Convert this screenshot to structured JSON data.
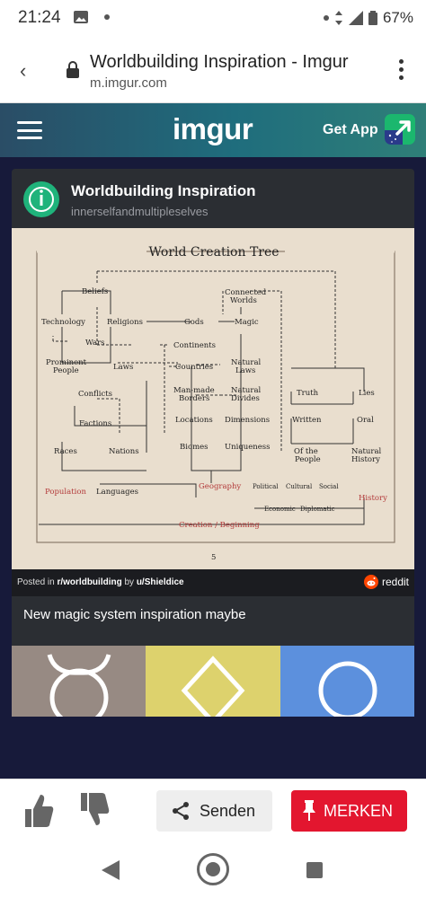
{
  "status_bar": {
    "time": "21:24",
    "battery": "67%"
  },
  "browser": {
    "title": "Worldbuilding Inspiration - Imgur",
    "url": "m.imgur.com"
  },
  "imgur_header": {
    "logo": "imgur",
    "get_app": "Get App"
  },
  "post": {
    "title": "Worldbuilding Inspiration",
    "username": "innerselfandmultipleselves",
    "posted_prefix": "Posted in ",
    "subreddit": "r/worldbuilding",
    "posted_by": " by ",
    "author": "u/Shieldice",
    "source_badge": "reddit",
    "description": "New magic system inspiration maybe"
  },
  "diagram": {
    "title": "World Creation Tree",
    "page_number": "5",
    "nodes": {
      "beliefs": "Beliefs",
      "technology": "Technology",
      "religions": "Religions",
      "gods": "Gods",
      "magic": "Magic",
      "connected_worlds_1": "Connected",
      "connected_worlds_2": "Worlds",
      "wars": "Wars",
      "prominent_1": "Prominent",
      "prominent_2": "People",
      "laws": "Laws",
      "continents": "Continents",
      "countries": "Countries",
      "natural_laws_1": "Natural",
      "natural_laws_2": "Laws",
      "conflicts": "Conflicts",
      "manmade_1": "Man-made",
      "manmade_2": "Borders",
      "natural_divides_1": "Natural",
      "natural_divides_2": "Divides",
      "truth": "Truth",
      "lies": "Lies",
      "factions": "Factions",
      "locations": "Locations",
      "dimensions": "Dimensions",
      "written": "Written",
      "oral": "Oral",
      "races": "Races",
      "nations": "Nations",
      "biomes": "Biomes",
      "uniqueness": "Uniqueness",
      "of_the_1": "Of the",
      "of_the_2": "People",
      "natural_history_1": "Natural",
      "natural_history_2": "History",
      "population": "Population",
      "languages": "Languages",
      "geography": "Geography",
      "political": "Political",
      "cultural": "Cultural",
      "social": "Social",
      "history": "History",
      "economic": "Economic",
      "diplomatic": "Diplomatic",
      "creation": "Creation / Beginning"
    }
  },
  "actions": {
    "share": "Senden",
    "save": "MERKEN"
  },
  "colors": {
    "accent_red": "#e3162f",
    "imgur_green": "#1bb76e",
    "feed_bg": "#171a3a"
  }
}
